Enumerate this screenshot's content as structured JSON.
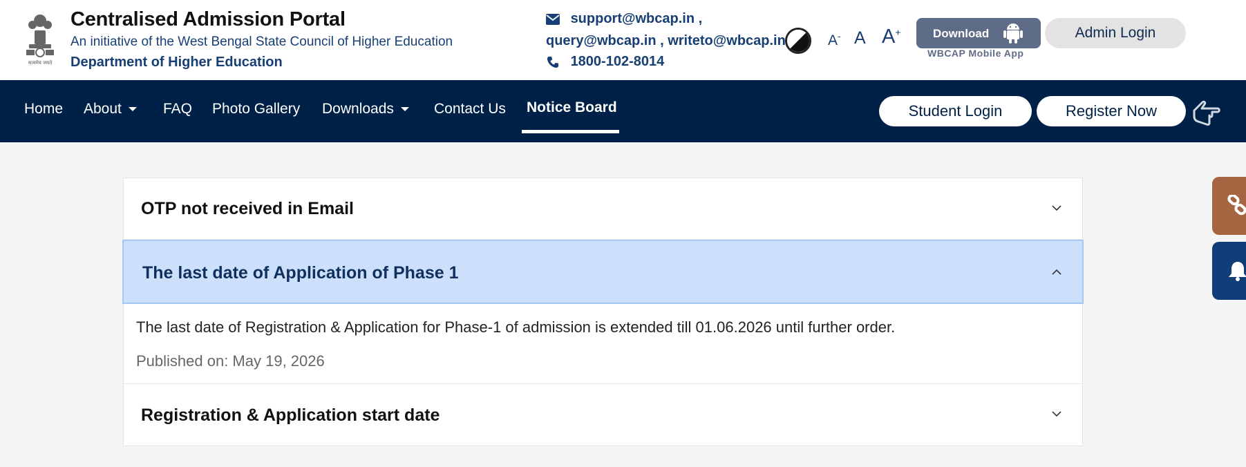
{
  "header": {
    "title": "Centralised Admission Portal",
    "subtitle": "An initiative of the West Bengal State Council of Higher Education",
    "department": "Department of Higher Education",
    "emblem_caption": "सत्यमेव जयते",
    "contact": {
      "email_line1": "support@wbcap.in ,",
      "email_line2": "query@wbcap.in , writeto@wbcap.in",
      "phone": "1800-102-8014"
    },
    "font_controls": {
      "decrease": "A",
      "normal": "A",
      "increase": "A",
      "decrease_sign": "-",
      "increase_sign": "+"
    },
    "download": {
      "label": "Download",
      "sub": "WBCAP Mobile App"
    },
    "admin_login": "Admin Login"
  },
  "nav": {
    "items": [
      {
        "label": "Home"
      },
      {
        "label": "About"
      },
      {
        "label": "FAQ"
      },
      {
        "label": "Photo Gallery"
      },
      {
        "label": "Downloads"
      },
      {
        "label": "Contact Us"
      },
      {
        "label": "Notice Board"
      }
    ],
    "student_login": "Student Login",
    "register_now": "Register Now"
  },
  "notices": [
    {
      "title": "OTP not received in Email",
      "expanded": false
    },
    {
      "title": "The last date of Application of Phase 1",
      "expanded": true,
      "body": "The last date of Registration & Application for Phase-1 of admission is extended till 01.06.2026 until further order.",
      "published": "Published on: May 19, 2026"
    },
    {
      "title": "Registration & Application start date",
      "expanded": false
    }
  ],
  "colors": {
    "nav_bg": "#002147",
    "accent_text": "#173f73",
    "expanded_bg": "#cde0fb",
    "side_tab_link": "#a46540",
    "side_tab_bell": "#0f3e78"
  },
  "icons": {
    "email": "envelope-icon",
    "phone": "phone-icon",
    "contrast": "contrast-icon",
    "android": "android-icon",
    "accessibility": "hand-pointer-icon",
    "side_link": "link-icon",
    "side_bell": "bell-icon"
  }
}
